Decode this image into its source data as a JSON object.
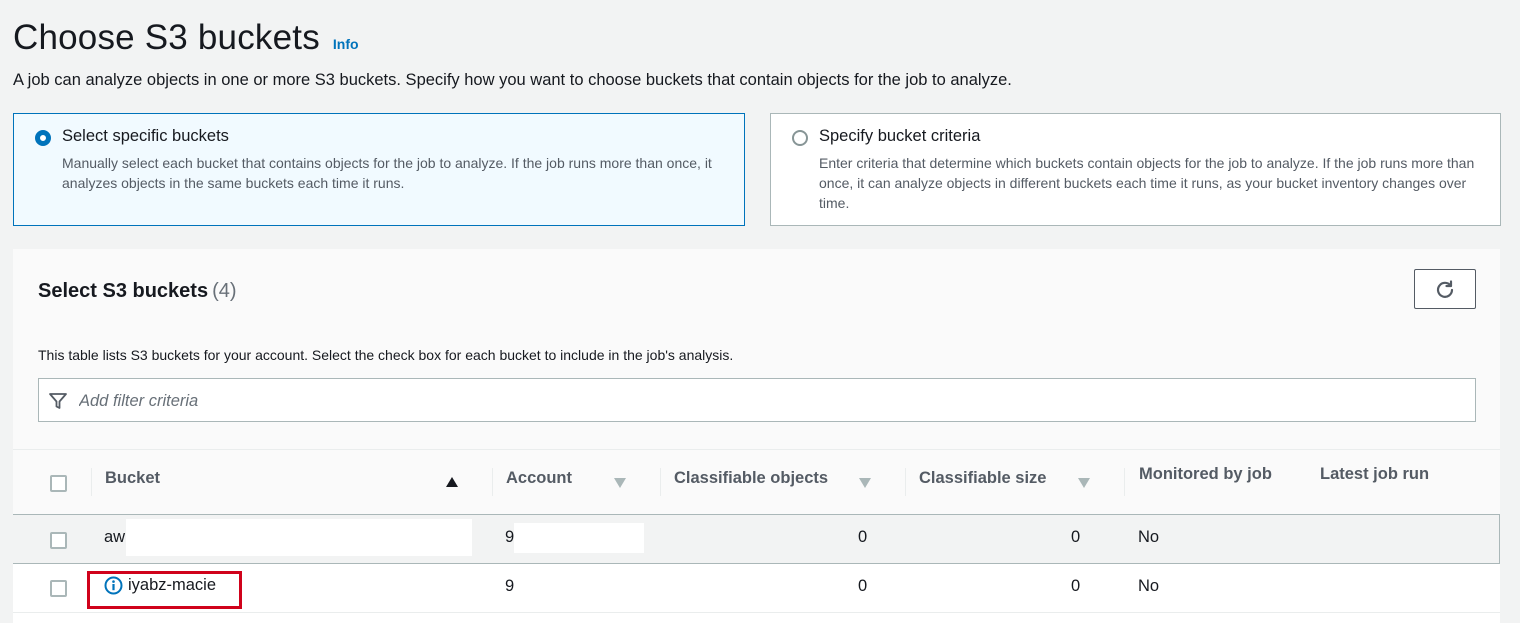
{
  "header": {
    "title": "Choose S3 buckets",
    "info_label": "Info",
    "description": "A job can analyze objects in one or more S3 buckets. Specify how you want to choose buckets that contain objects for the job to analyze."
  },
  "selection_mode": {
    "options": [
      {
        "label": "Select specific buckets",
        "description": "Manually select each bucket that contains objects for the job to analyze. If the job runs more than once, it analyzes objects in the same buckets each time it runs.",
        "selected": true
      },
      {
        "label": "Specify bucket criteria",
        "description": "Enter criteria that determine which buckets contain objects for the job to analyze. If the job runs more than once, it can analyze objects in different buckets each time it runs, as your bucket inventory changes over time.",
        "selected": false
      }
    ]
  },
  "bucket_table": {
    "title": "Select S3 buckets",
    "count": "(4)",
    "description": "This table lists S3 buckets for your account. Select the check box for each bucket to include in the job's analysis.",
    "filter_placeholder": "Add filter criteria",
    "columns": [
      "Bucket",
      "Account",
      "Classifiable objects",
      "Classifiable size",
      "Monitored by job",
      "Latest job run"
    ],
    "rows": [
      {
        "bucket": "aw",
        "account": "9",
        "classifiable_objects": "0",
        "classifiable_size": "0",
        "monitored_by_job": "No",
        "latest_job_run": ""
      },
      {
        "bucket": "iyabz-macie",
        "account": "9",
        "classifiable_objects": "0",
        "classifiable_size": "0",
        "monitored_by_job": "No",
        "latest_job_run": ""
      }
    ]
  },
  "colors": {
    "accent": "#0073bb",
    "highlight_box": "#d0021b",
    "selected_tile_bg": "#f1faff"
  }
}
